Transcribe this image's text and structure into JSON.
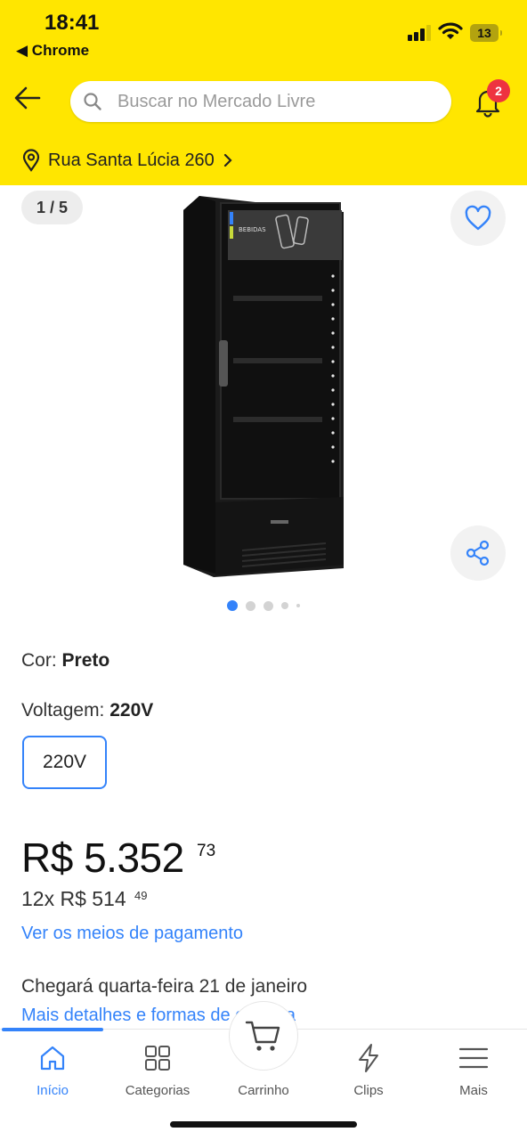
{
  "status_bar": {
    "time": "18:41",
    "back_app": "Chrome",
    "battery": "13"
  },
  "search": {
    "placeholder": "Buscar no Mercado Livre"
  },
  "notifications": {
    "count": "2"
  },
  "address": {
    "text": "Rua Santa Lúcia 260"
  },
  "gallery": {
    "pager": "1 / 5",
    "total_images": 5,
    "current_index": 0,
    "product_brand_text": "BEBIDAS"
  },
  "product": {
    "color_label": "Cor:",
    "color_value": "Preto",
    "voltage_label": "Voltagem:",
    "voltage_value": "220V",
    "voltage_options": [
      "220V"
    ],
    "price_main": "R$ 5.352",
    "price_cents": "73",
    "installments_main": "12x R$ 514",
    "installments_cents": "49",
    "payment_link": "Ver os meios de pagamento",
    "delivery_text": "Chegará quarta-feira 21 de janeiro",
    "delivery_link": "Mais detalhes e formas de entrega"
  },
  "tabbar": {
    "items": [
      {
        "label": "Início",
        "icon": "home-icon",
        "active": true
      },
      {
        "label": "Categorias",
        "icon": "grid-icon",
        "active": false
      },
      {
        "label": "Carrinho",
        "icon": "cart-icon",
        "active": false
      },
      {
        "label": "Clips",
        "icon": "lightning-icon",
        "active": false
      },
      {
        "label": "Mais",
        "icon": "menu-icon",
        "active": false
      }
    ]
  },
  "colors": {
    "brand_yellow": "#ffe600",
    "accent_blue": "#3483fa",
    "badge_red": "#ee3340"
  }
}
